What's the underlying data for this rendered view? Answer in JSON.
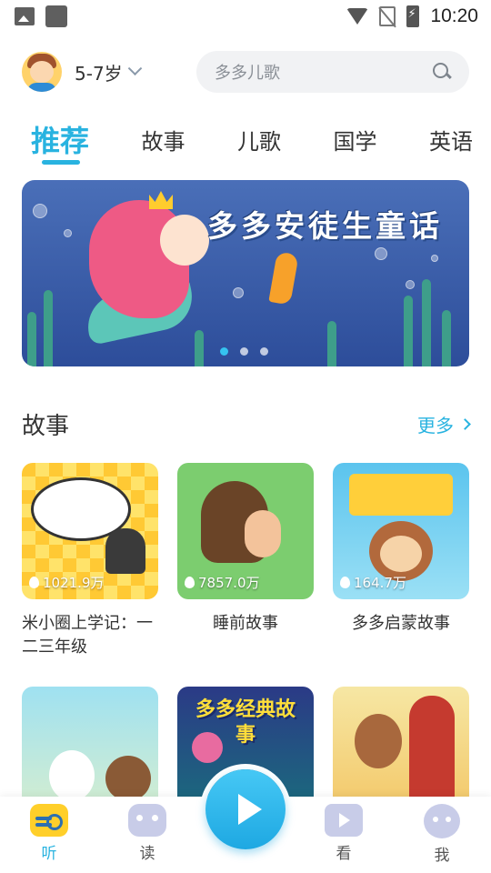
{
  "status_bar": {
    "time": "10:20"
  },
  "header": {
    "age_label": "5-7岁",
    "search_placeholder": "多多儿歌"
  },
  "tabs": [
    {
      "label": "推荐",
      "active": true
    },
    {
      "label": "故事",
      "active": false
    },
    {
      "label": "儿歌",
      "active": false
    },
    {
      "label": "国学",
      "active": false
    },
    {
      "label": "英语",
      "active": false
    }
  ],
  "banner": {
    "title": "多多安徒生童话",
    "slide_count": 3,
    "active_slide": 1
  },
  "section": {
    "title": "故事",
    "more_label": "更多"
  },
  "cards": [
    {
      "title": "米小圈上学记：一二三年级",
      "plays": "1021.9万"
    },
    {
      "title": "睡前故事",
      "plays": "7857.0万"
    },
    {
      "title": "多多启蒙故事",
      "plays": "164.7万"
    }
  ],
  "cards_row2": [
    {
      "thumb_text": "多多经典故事"
    }
  ],
  "bottom_nav": [
    {
      "label": "听",
      "icon": "radio-icon",
      "active": true
    },
    {
      "label": "读",
      "icon": "robot-face-icon",
      "active": false
    },
    {
      "label": "看",
      "icon": "tv-icon",
      "active": false
    },
    {
      "label": "我",
      "icon": "robot-head-icon",
      "active": false
    }
  ],
  "colors": {
    "accent": "#29b3e0",
    "text": "#333333",
    "search_bg": "#f1f2f4"
  }
}
